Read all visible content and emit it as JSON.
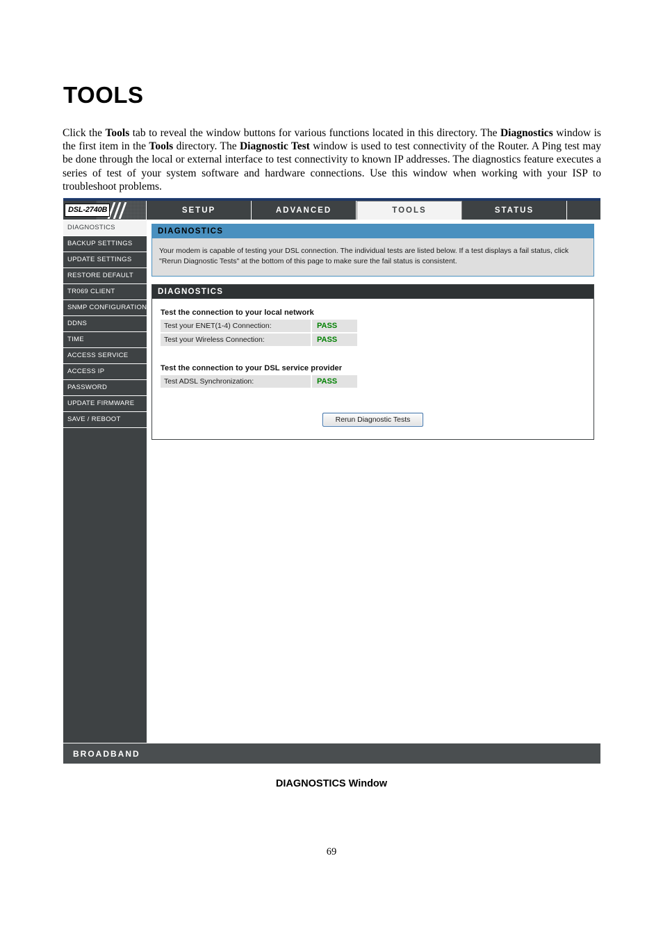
{
  "document": {
    "title": "TOOLS",
    "paragraph_parts": [
      {
        "text": "Click the ",
        "bold": false
      },
      {
        "text": "Tools",
        "bold": true
      },
      {
        "text": " tab to reveal the window buttons for various functions located in this directory. The ",
        "bold": false
      },
      {
        "text": "Diagnostics",
        "bold": true
      },
      {
        "text": " window is the first item in the ",
        "bold": false
      },
      {
        "text": "Tools",
        "bold": true
      },
      {
        "text": " directory. The ",
        "bold": false
      },
      {
        "text": "Diagnostic Test",
        "bold": true
      },
      {
        "text": " window is used to test connectivity of the Router. A Ping test may be done through the local or external interface to test connectivity to known IP addresses. The diagnostics feature executes a series of test of your system software and hardware connections. Use this window when working with your ISP to troubleshoot problems.",
        "bold": false
      }
    ],
    "caption": "DIAGNOSTICS Window",
    "page_number": "69"
  },
  "router_ui": {
    "logo": "DSL-2740B",
    "nav_tabs": [
      {
        "label": "SETUP",
        "active": false
      },
      {
        "label": "ADVANCED",
        "active": false
      },
      {
        "label": "TOOLS",
        "active": true
      },
      {
        "label": "STATUS",
        "active": false
      }
    ],
    "sidebar": {
      "items": [
        {
          "label": "DIAGNOSTICS",
          "active": true
        },
        {
          "label": "BACKUP SETTINGS",
          "active": false
        },
        {
          "label": "UPDATE SETTINGS",
          "active": false
        },
        {
          "label": "RESTORE DEFAULT",
          "active": false
        },
        {
          "label": "TR069 CLIENT",
          "active": false
        },
        {
          "label": "SNMP CONFIGURATION",
          "active": false
        },
        {
          "label": "DDNS",
          "active": false
        },
        {
          "label": "TIME",
          "active": false
        },
        {
          "label": "ACCESS SERVICE",
          "active": false
        },
        {
          "label": "ACCESS IP",
          "active": false
        },
        {
          "label": "PASSWORD",
          "active": false
        },
        {
          "label": "UPDATE FIRMWARE",
          "active": false
        },
        {
          "label": "SAVE / REBOOT",
          "active": false
        }
      ]
    },
    "info_panel": {
      "header": "DIAGNOSTICS",
      "body": "Your modem is capable of testing your DSL connection. The individual tests are listed below. If a test displays a fail status, click \"Rerun Diagnostic Tests\" at the bottom of this page to make sure the fail status is consistent."
    },
    "diagnostics_panel": {
      "header": "DIAGNOSTICS",
      "groups": [
        {
          "title": "Test the connection to your local network",
          "rows": [
            {
              "label": "Test your ENET(1-4) Connection:",
              "result": "PASS"
            },
            {
              "label": "Test your Wireless Connection:",
              "result": "PASS"
            }
          ]
        },
        {
          "title": "Test the connection to your DSL service provider",
          "rows": [
            {
              "label": "Test ADSL Synchronization:",
              "result": "PASS"
            }
          ]
        }
      ],
      "rerun_button": "Rerun Diagnostic Tests"
    },
    "footer": {
      "label": "BROADBAND"
    },
    "colors": {
      "accent_blue": "#4a90bf",
      "dark": "#3e4244",
      "pass_green": "#008000",
      "panel_gray": "#dedede"
    }
  }
}
